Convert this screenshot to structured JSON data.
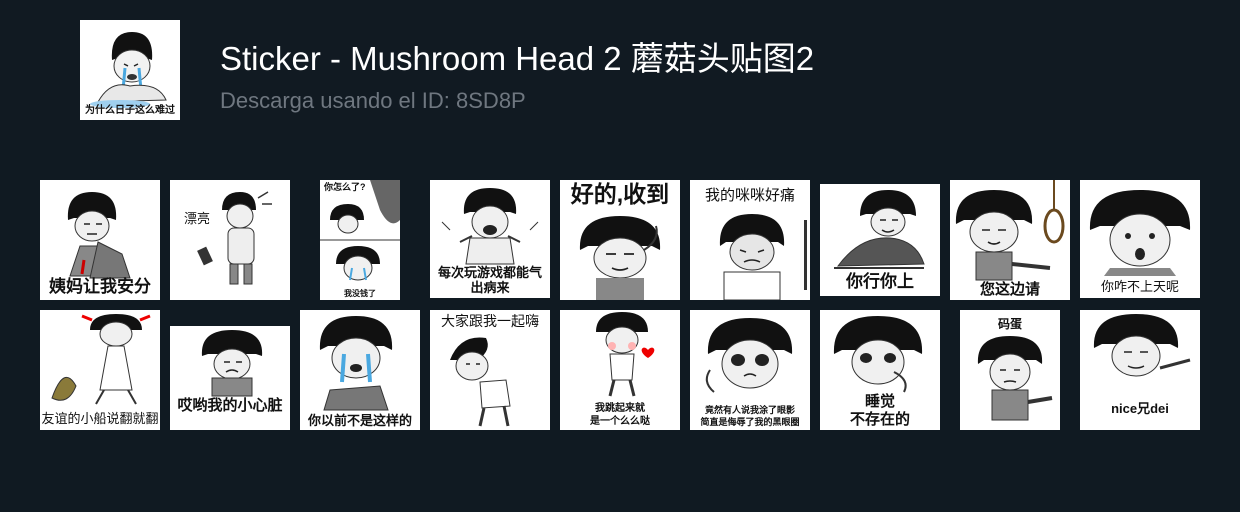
{
  "header": {
    "title": "Sticker - Mushroom Head 2 蘑菇头贴图2",
    "subtitle": "Descarga usando el ID: 8SD8P",
    "cover_caption": "为什么日子这么难过"
  },
  "stickers": [
    {
      "caption": "姨妈让我安分"
    },
    {
      "caption": "漂亮"
    },
    {
      "caption_top": "你怎么了?",
      "caption": "我没钱了"
    },
    {
      "caption": "每次玩游戏都能气",
      "caption2": "出病来"
    },
    {
      "caption": "好的,收到"
    },
    {
      "caption": "我的咪咪好痛"
    },
    {
      "caption": "你行你上"
    },
    {
      "caption": "您这边请"
    },
    {
      "caption": "你咋不上天呢"
    },
    {
      "caption": "友谊的小船说翻就翻"
    },
    {
      "caption": "哎哟我的小心脏"
    },
    {
      "caption": "你以前不是这样的"
    },
    {
      "caption": "大家跟我一起嗨"
    },
    {
      "caption": "我跳起来就",
      "caption2": "是一个么么哒"
    },
    {
      "caption": "竟然有人说我涂了眼影",
      "caption2": "简直是侮辱了我的黑眼圈"
    },
    {
      "caption": "睡觉",
      "caption2": "不存在的"
    },
    {
      "caption": "码蛋"
    },
    {
      "caption": "nice兄dei"
    }
  ]
}
